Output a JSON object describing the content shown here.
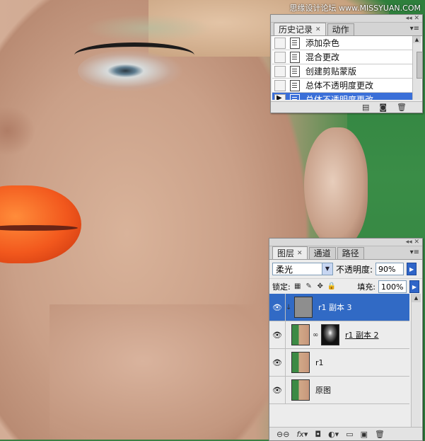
{
  "watermark": "思缘设计论坛 www.MISSYUAN.COM",
  "history_panel": {
    "tabs": [
      {
        "label": "历史记录",
        "active": true
      },
      {
        "label": "动作",
        "active": false
      }
    ],
    "items": [
      {
        "label": "添加杂色",
        "selected": false
      },
      {
        "label": "混合更改",
        "selected": false
      },
      {
        "label": "创建剪贴蒙版",
        "selected": false
      },
      {
        "label": "总体不透明度更改",
        "selected": false
      },
      {
        "label": "总体不透明度更改",
        "selected": true
      }
    ]
  },
  "layers_panel": {
    "tabs": [
      {
        "label": "图层",
        "active": true
      },
      {
        "label": "通道",
        "active": false
      },
      {
        "label": "路径",
        "active": false
      }
    ],
    "blend_mode": "柔光",
    "opacity_label": "不透明度:",
    "opacity_value": "90%",
    "lock_label": "锁定:",
    "fill_label": "填充:",
    "fill_value": "100%",
    "layers": [
      {
        "name": "r1 副本 3",
        "selected": true,
        "thumb": "gray",
        "mask": false
      },
      {
        "name": "r1 副本 2",
        "selected": false,
        "thumb": "photo",
        "mask": true
      },
      {
        "name": "r1",
        "selected": false,
        "thumb": "photo",
        "mask": false
      },
      {
        "name": "原图",
        "selected": false,
        "thumb": "photo",
        "mask": false
      }
    ],
    "footer_icons": [
      "link-icon",
      "fx-icon",
      "mask-icon",
      "adjustment-icon",
      "group-icon",
      "new-layer-icon",
      "trash-icon"
    ]
  },
  "colors": {
    "selection": "#316ac5",
    "panel_bg": "#ececec"
  }
}
